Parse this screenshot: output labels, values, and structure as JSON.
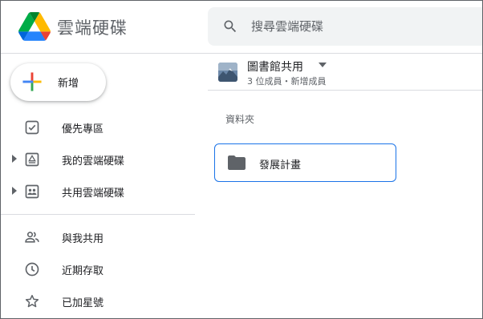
{
  "header": {
    "app_name": "雲端硬碟",
    "search_placeholder": "搜尋雲端硬碟"
  },
  "sidebar": {
    "new_label": "新增",
    "items": [
      {
        "label": "優先專區",
        "icon": "priority-icon"
      },
      {
        "label": "我的雲端硬碟",
        "icon": "my-drive-icon",
        "expandable": true
      },
      {
        "label": "共用雲端硬碟",
        "icon": "shared-drives-icon",
        "expandable": true
      },
      {
        "label": "與我共用",
        "icon": "people-icon"
      },
      {
        "label": "近期存取",
        "icon": "clock-icon"
      },
      {
        "label": "已加星號",
        "icon": "star-icon"
      }
    ]
  },
  "main": {
    "drive_title": "圖書館共用",
    "drive_meta": "3 位成員・新增成員",
    "section_label": "資料夾",
    "folders": [
      {
        "name": "發展計畫"
      }
    ]
  },
  "colors": {
    "accent": "#1a73e8",
    "icon": "#5f6368",
    "divider": "#dadce0",
    "search_bg": "#f1f3f4"
  }
}
